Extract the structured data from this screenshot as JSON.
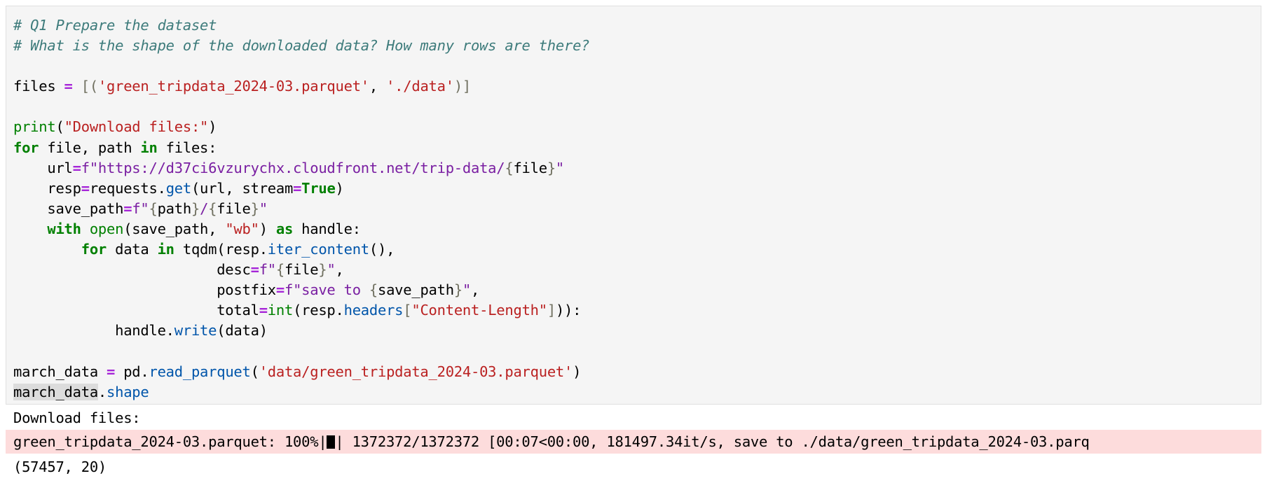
{
  "code": {
    "l1": "# Q1 Prepare the dataset",
    "l2": "# What is the shape of the downloaded data? How many rows are there?",
    "l4": {
      "var": "files",
      "op": " = ",
      "open": "[(",
      "s1": "'green_tripdata_2024-03.parquet'",
      "comma": ", ",
      "s2": "'./data'",
      "close": ")]"
    },
    "l6": {
      "fn": "print",
      "open": "(",
      "s": "\"Download files:\"",
      "close": ")"
    },
    "l7": {
      "kw1": "for",
      "t1": " file, path ",
      "kw2": "in",
      "t2": " files:"
    },
    "l8": {
      "indent": "    ",
      "var": "url",
      "op": "=",
      "f": "f",
      "s": "\"https://d37ci6vzurychx.cloudfront.net/trip-data/",
      "b1": "{",
      "inner": "file",
      "b2": "}",
      "end": "\""
    },
    "l9": {
      "indent": "    ",
      "var": "resp",
      "op": "=",
      "t1": "requests.",
      "attr": "get",
      "t2": "(url, stream",
      "op2": "=",
      "kw": "True",
      "t3": ")"
    },
    "l10": {
      "indent": "    ",
      "var": "save_path",
      "op": "=",
      "f": "f",
      "q": "\"",
      "b1": "{",
      "inner1": "path",
      "b2": "}",
      "slash": "/",
      "b3": "{",
      "inner2": "file",
      "b4": "}",
      "q2": "\""
    },
    "l11": {
      "indent": "    ",
      "kw1": "with",
      "sp": " ",
      "fn": "open",
      "t1": "(save_path, ",
      "s": "\"wb\"",
      "t2": ") ",
      "kw2": "as",
      "t3": " handle:"
    },
    "l12": {
      "indent": "        ",
      "kw1": "for",
      "t1": " data ",
      "kw2": "in",
      "t2": " tqdm(resp.",
      "attr": "iter_content",
      "t3": "(),"
    },
    "l13": {
      "indent": "                        ",
      "t1": "desc",
      "op": "=",
      "f": "f",
      "q": "\"",
      "b1": "{",
      "inner": "file",
      "b2": "}",
      "q2": "\"",
      "end": ","
    },
    "l14": {
      "indent": "                        ",
      "t1": "postfix",
      "op": "=",
      "f": "f",
      "s": "\"save to ",
      "b1": "{",
      "inner": "save_path",
      "b2": "}",
      "q2": "\"",
      "end": ","
    },
    "l15": {
      "indent": "                        ",
      "t1": "total",
      "op": "=",
      "fn": "int",
      "t2": "(resp.",
      "attr": "headers",
      "b1": "[",
      "s": "\"Content-Length\"",
      "b2": "]",
      "end": ")):"
    },
    "l16": {
      "indent": "            ",
      "t1": "handle.",
      "attr": "write",
      "t2": "(data)"
    },
    "l18": {
      "var": "march_data",
      "op": " = ",
      "t1": "pd.",
      "attr": "read_parquet",
      "t2": "(",
      "s": "'data/green_tripdata_2024-03.parquet'",
      "t3": ")"
    },
    "l19": {
      "sel": "march_data",
      "dot": ".",
      "attr": "shape"
    }
  },
  "output": {
    "line1": "Download files:",
    "line2_pre": "green_tripdata_2024-03.parquet: 100%|",
    "line2_post": "| 1372372/1372372 [00:07<00:00, 181497.34it/s, save to ./data/green_tripdata_2024-03.parq",
    "line3": "(57457, 20)"
  }
}
